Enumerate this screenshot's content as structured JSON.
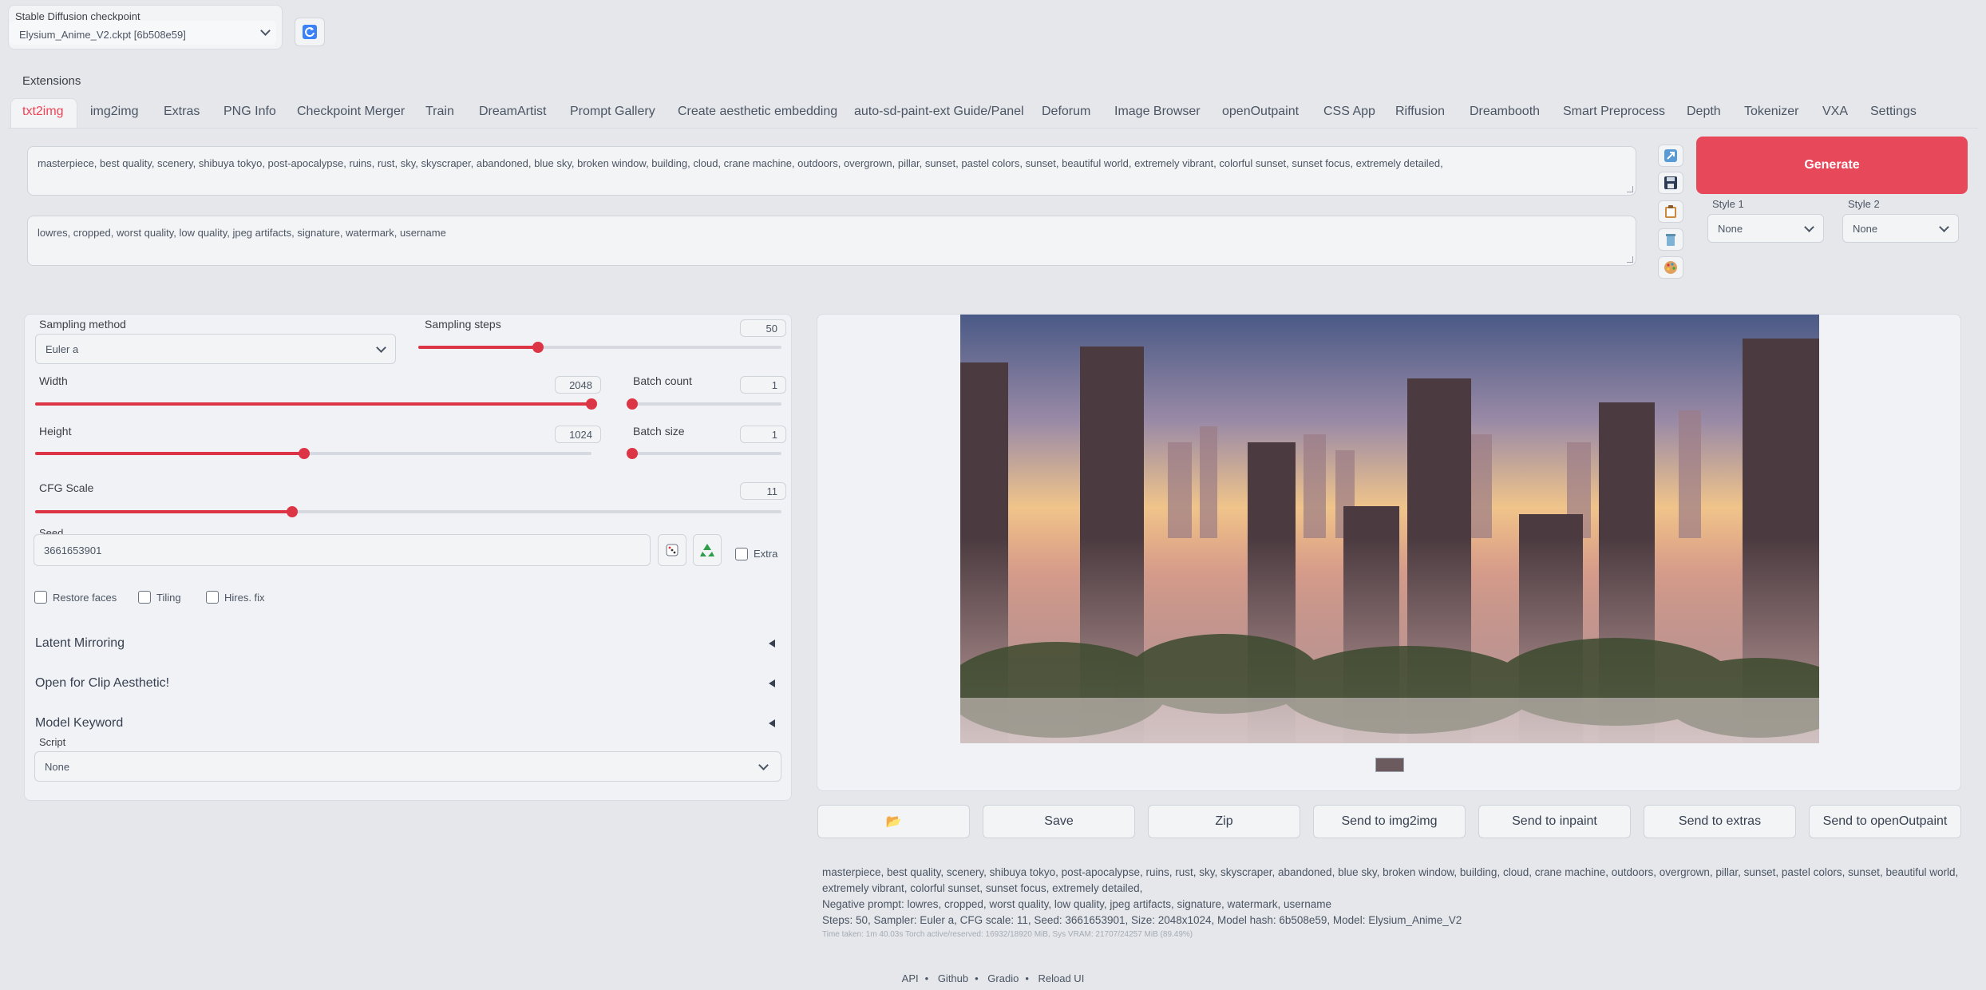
{
  "checkpoint": {
    "label": "Stable Diffusion checkpoint",
    "value": "Elysium_Anime_V2.ckpt [6b508e59]",
    "refresh_icon": "refresh-icon"
  },
  "extensions_label": "Extensions",
  "tabs": [
    "txt2img",
    "img2img",
    "Extras",
    "PNG Info",
    "Checkpoint Merger",
    "Train",
    "DreamArtist",
    "Prompt Gallery",
    "Create aesthetic embedding",
    "auto-sd-paint-ext Guide/Panel",
    "Deforum",
    "Image Browser",
    "openOutpaint",
    "CSS App",
    "Riffusion",
    "Dreambooth",
    "Smart Preprocess",
    "Depth",
    "Tokenizer",
    "VXA",
    "Settings"
  ],
  "active_tab": "txt2img",
  "prompt": "masterpiece, best quality, scenery, shibuya tokyo, post-apocalypse, ruins, rust, sky, skyscraper, abandoned, blue sky, broken window, building, cloud, crane machine, outdoors, overgrown, pillar, sunset, pastel colors, sunset, beautiful world, extremely vibrant, colorful sunset, sunset focus, extremely detailed,",
  "negative_prompt": "lowres, cropped, worst quality, low quality, jpeg artifacts, signature, watermark, username",
  "tool_icons": [
    "arrow-icon",
    "save-icon",
    "clipboard-icon",
    "trash-icon",
    "palette-icon"
  ],
  "generate_label": "Generate",
  "style1": {
    "label": "Style 1",
    "value": "None"
  },
  "style2": {
    "label": "Style 2",
    "value": "None"
  },
  "sampling_method": {
    "label": "Sampling method",
    "value": "Euler a"
  },
  "sampling_steps": {
    "label": "Sampling steps",
    "value": "50",
    "min": 1,
    "max": 150,
    "num": 50
  },
  "width": {
    "label": "Width",
    "value": "2048",
    "min": 64,
    "max": 2048,
    "num": 2048
  },
  "height": {
    "label": "Height",
    "value": "1024",
    "min": 64,
    "max": 2048,
    "num": 1024
  },
  "batch_count": {
    "label": "Batch count",
    "value": "1",
    "min": 1,
    "max": 100,
    "num": 1
  },
  "batch_size": {
    "label": "Batch size",
    "value": "1",
    "min": 1,
    "max": 8,
    "num": 1
  },
  "cfg_scale": {
    "label": "CFG Scale",
    "value": "11",
    "min": 1,
    "max": 30,
    "num": 11
  },
  "seed": {
    "label": "Seed",
    "value": "3661653901",
    "extra_label": "Extra"
  },
  "checkboxes": {
    "restore_faces": "Restore faces",
    "tiling": "Tiling",
    "hires_fix": "Hires. fix"
  },
  "accordions": [
    "Latent Mirroring",
    "Open for Clip Aesthetic!",
    "Model Keyword"
  ],
  "script": {
    "label": "Script",
    "value": "None"
  },
  "output_buttons": {
    "folder_icon": "📂",
    "save": "Save",
    "zip": "Zip",
    "send_img2img": "Send to img2img",
    "send_inpaint": "Send to inpaint",
    "send_extras": "Send to extras",
    "send_openoutpaint": "Send to openOutpaint"
  },
  "generation_info": {
    "prompt_line": "masterpiece, best quality, scenery, shibuya tokyo, post-apocalypse, ruins, rust, sky, skyscraper, abandoned, blue sky, broken window, building, cloud, crane machine, outdoors, overgrown, pillar, sunset, pastel colors, sunset, beautiful world, extremely vibrant, colorful sunset, sunset focus, extremely detailed,",
    "negative_line": "Negative prompt: lowres, cropped, worst quality, low quality, jpeg artifacts, signature, watermark, username",
    "params_line": "Steps: 50, Sampler: Euler a, CFG scale: 11, Seed: 3661653901, Size: 2048x1024, Model hash: 6b508e59, Model: Elysium_Anime_V2",
    "time_line": "Time taken: 1m 40.03s  Torch active/reserved: 16932/18920 MiB, Sys VRAM: 21707/24257 MiB (89.49%)"
  },
  "footer": [
    "API",
    "Github",
    "Gradio",
    "Reload UI"
  ],
  "colors": {
    "accent": "#e8495a",
    "slider": "#dc3545",
    "background": "#e5e7eb"
  }
}
